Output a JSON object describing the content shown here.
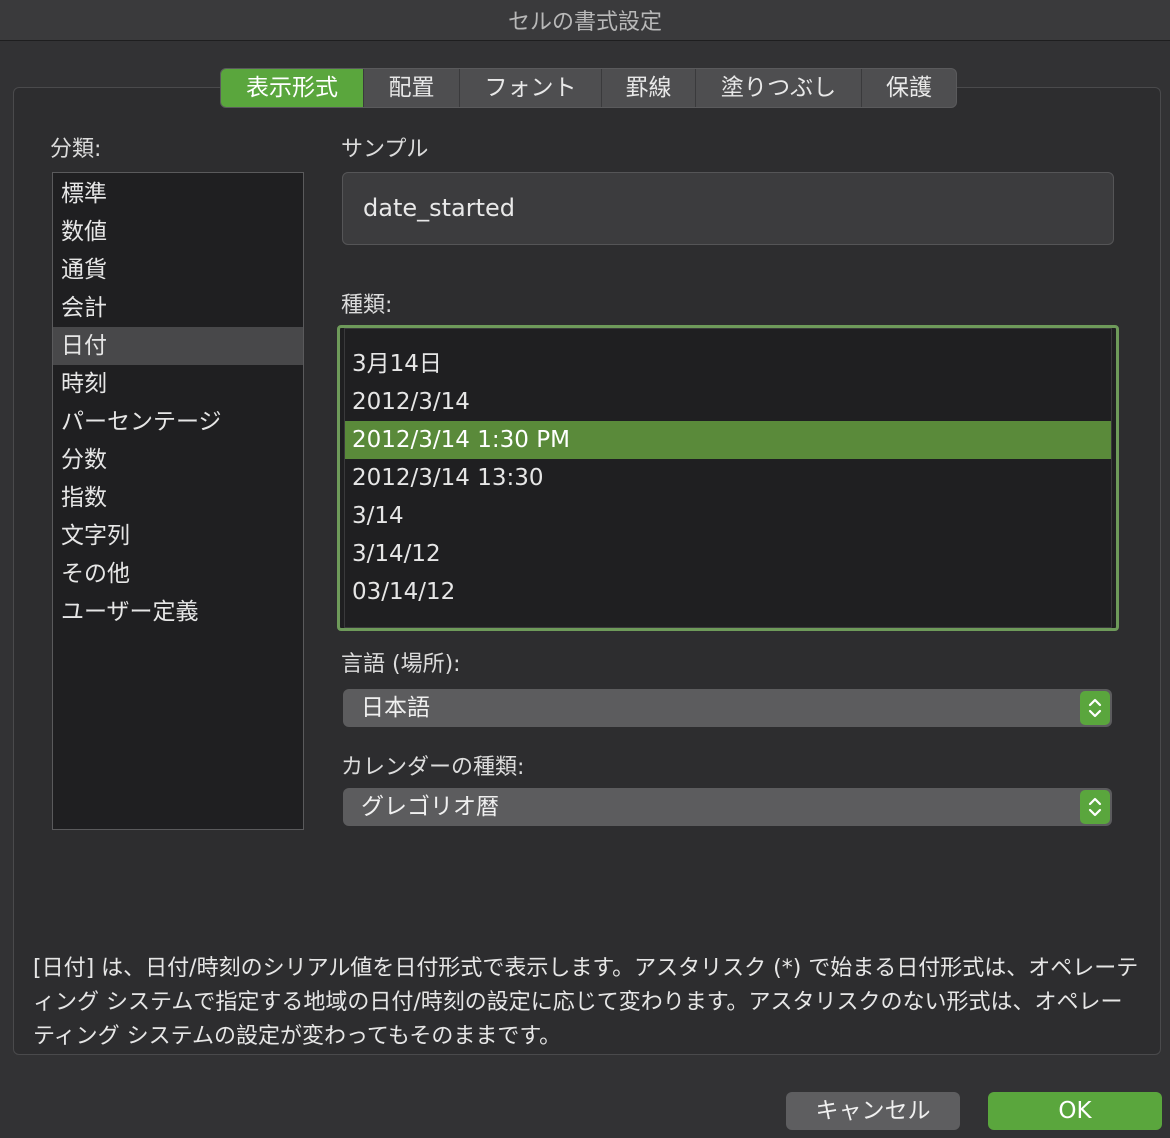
{
  "window": {
    "title": "セルの書式設定"
  },
  "tabs": [
    {
      "label": "表示形式",
      "active": true
    },
    {
      "label": "配置"
    },
    {
      "label": "フォント"
    },
    {
      "label": "罫線"
    },
    {
      "label": "塗りつぶし"
    },
    {
      "label": "保護"
    }
  ],
  "category": {
    "label": "分類:",
    "items": [
      "標準",
      "数値",
      "通貨",
      "会計",
      "日付",
      "時刻",
      "パーセンテージ",
      "分数",
      "指数",
      "文字列",
      "その他",
      "ユーザー定義"
    ],
    "selected": "日付"
  },
  "sample": {
    "label": "サンプル",
    "value": "date_started"
  },
  "type": {
    "label": "種類:",
    "items": [
      "3月14日",
      "2012/3/14",
      "2012/3/14 1:30 PM",
      "2012/3/14 13:30",
      "3/14",
      "3/14/12",
      "03/14/12"
    ],
    "selected": "2012/3/14 1:30 PM"
  },
  "locale": {
    "label": "言語 (場所):",
    "value": "日本語"
  },
  "calendar": {
    "label": "カレンダーの種類:",
    "value": "グレゴリオ暦"
  },
  "description": "[日付] は、日付/時刻のシリアル値を日付形式で表示します。アスタリスク (*) で始まる日付形式は、オペレーティング システムで指定する地域の日付/時刻の設定に応じて変わります。アスタリスクのない形式は、オペレーティング システムの設定が変わってもそのままです。",
  "buttons": {
    "cancel": "キャンセル",
    "ok": "OK"
  },
  "colors": {
    "accent": "#5aa63d",
    "selection": "#5a8a3a",
    "background": "#323234"
  }
}
